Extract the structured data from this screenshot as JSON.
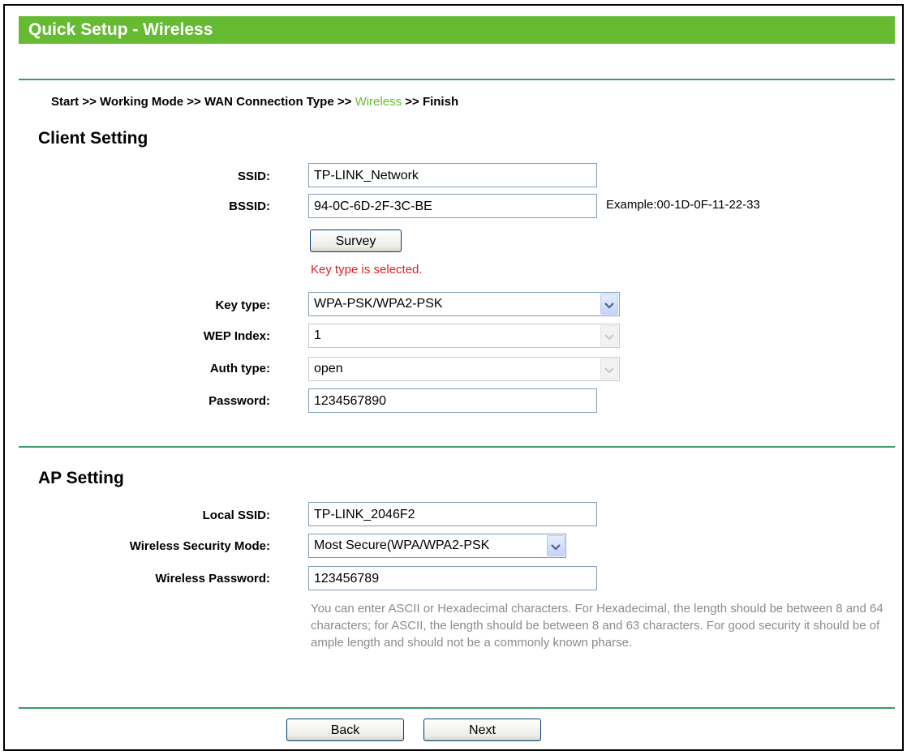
{
  "header": {
    "title": "Quick Setup - Wireless"
  },
  "breadcrumb": {
    "start": "Start",
    "sep1": " >> ",
    "working_mode": "Working Mode",
    "sep2": " >> ",
    "wan": "WAN Connection Type",
    "sep3": " >> ",
    "wireless": "Wireless",
    "sep4": " >> ",
    "finish": "Finish"
  },
  "client": {
    "title": "Client Setting",
    "ssid_label": "SSID:",
    "ssid_value": "TP-LINK_Network",
    "bssid_label": "BSSID:",
    "bssid_value": "94-0C-6D-2F-3C-BE",
    "bssid_example": "Example:00-1D-0F-11-22-33",
    "survey_label": "Survey",
    "status_message": "Key type is selected.",
    "keytype_label": "Key type:",
    "keytype_value": "WPA-PSK/WPA2-PSK",
    "wepindex_label": "WEP Index:",
    "wepindex_value": "1",
    "authtype_label": "Auth type:",
    "authtype_value": "open",
    "password_label": "Password:",
    "password_value": "1234567890"
  },
  "ap": {
    "title": "AP Setting",
    "local_ssid_label": "Local SSID:",
    "local_ssid_value": "TP-LINK_2046F2",
    "security_mode_label": "Wireless Security Mode:",
    "security_mode_value": "Most Secure(WPA/WPA2-PSK",
    "wireless_password_label": "Wireless Password:",
    "wireless_password_value": "123456789",
    "note": "You can enter ASCII or Hexadecimal characters. For Hexadecimal, the length should be between 8 and 64 characters; for ASCII, the length should be between 8 and 63 characters. For good security it should be of ample length and should not be a commonly known pharse."
  },
  "footer": {
    "back_label": "Back",
    "next_label": "Next"
  },
  "colors": {
    "header_bg": "#66bb33",
    "rule": "#3a9a6a",
    "active_crumb": "#66bb33",
    "message": "#e02020",
    "note": "#8c8c8c"
  },
  "icons": {
    "dropdown": "chevron-down-icon"
  }
}
